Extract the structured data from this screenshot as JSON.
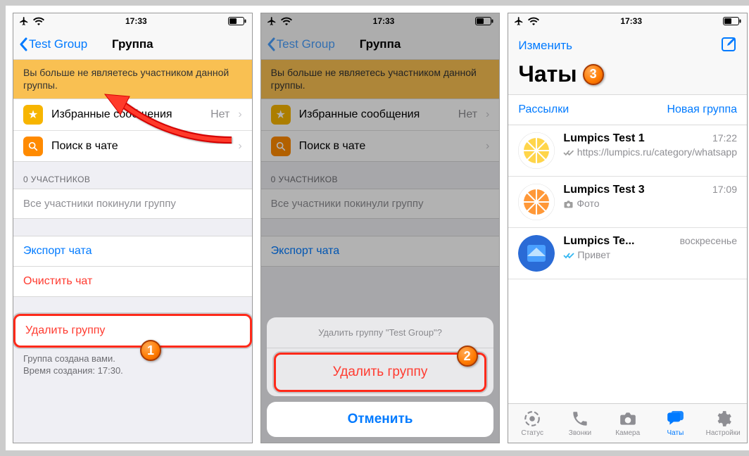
{
  "statusbar": {
    "time": "17:33"
  },
  "screen1": {
    "back_label": "Test Group",
    "title": "Группа",
    "banner": "Вы больше не являетесь участником данной группы.",
    "starred_label": "Избранные сообщения",
    "starred_count": "Нет",
    "search_label": "Поиск в чате",
    "participants_header": "0 УЧАСТНИКОВ",
    "all_left": "Все участники покинули группу",
    "export": "Экспорт чата",
    "clear": "Очистить чат",
    "delete": "Удалить группу",
    "footer_line1": "Группа создана вами.",
    "footer_line2": "Время создания: 17:30."
  },
  "screen2": {
    "sheet_prompt": "Удалить группу \"Test Group\"?",
    "sheet_delete": "Удалить группу",
    "sheet_cancel": "Отменить"
  },
  "screen3": {
    "edit": "Изменить",
    "title": "Чаты",
    "broadcasts": "Рассылки",
    "newgroup": "Новая группа",
    "chats": [
      {
        "name": "Lumpics Test 1",
        "preview": "https://lumpics.ru/category/whatsapp",
        "ts": "17:22",
        "ticks": "grey"
      },
      {
        "name": "Lumpics Test 3",
        "preview": "Фото",
        "ts": "17:09",
        "ticks": "none",
        "camera": true
      },
      {
        "name": "Lumpics Te...",
        "preview": "Привет",
        "ts": "воскресенье",
        "ticks": "blue"
      }
    ],
    "tabs": {
      "status": "Статус",
      "calls": "Звонки",
      "camera": "Камера",
      "chats": "Чаты",
      "settings": "Настройки"
    }
  },
  "markers": {
    "m1": "1",
    "m2": "2",
    "m3": "3"
  }
}
